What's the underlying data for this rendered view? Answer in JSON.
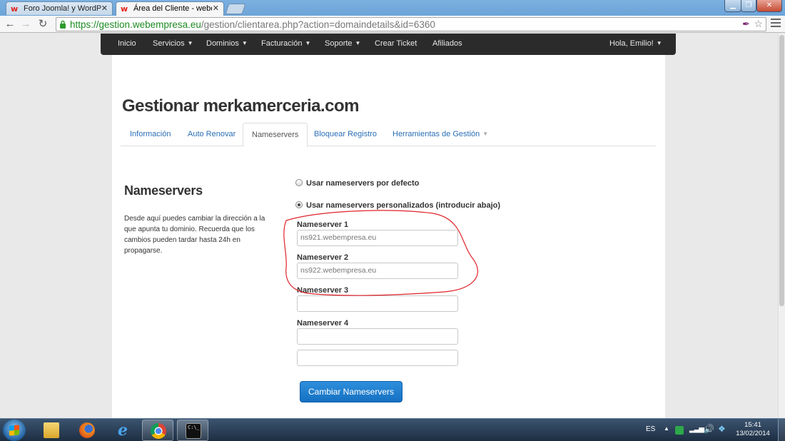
{
  "browser": {
    "tabs": [
      {
        "label": "Foro Joomla! y WordPress",
        "active": false
      },
      {
        "label": "Área del Cliente - webempresa",
        "active": true
      }
    ],
    "url": {
      "scheme": "https://",
      "host": "gestion.webempresa.eu",
      "path": "/gestion/clientarea.php?action=domaindetails&id=6360"
    }
  },
  "navbar": {
    "items": [
      {
        "label": "Inicio",
        "dropdown": false
      },
      {
        "label": "Servicios",
        "dropdown": true
      },
      {
        "label": "Dominios",
        "dropdown": true
      },
      {
        "label": "Facturación",
        "dropdown": true
      },
      {
        "label": "Soporte",
        "dropdown": true
      },
      {
        "label": "Crear Ticket",
        "dropdown": false
      },
      {
        "label": "Afiliados",
        "dropdown": false
      }
    ],
    "user_menu": "Hola, Emilio!"
  },
  "page": {
    "title": "Gestionar merkamerceria.com",
    "tabs": [
      {
        "label": "Información",
        "active": false
      },
      {
        "label": "Auto Renovar",
        "active": false
      },
      {
        "label": "Nameservers",
        "active": true
      },
      {
        "label": "Bloquear Registro",
        "active": false
      },
      {
        "label": "Herramientas de Gestión",
        "active": false,
        "dropdown": true
      }
    ]
  },
  "nameservers": {
    "title": "Nameservers",
    "description": "Desde aquí puedes cambiar la dirección a la que apunta tu dominio. Recuerda que los cambios pueden tardar hasta 24h en propagarse.",
    "option_default": "Usar nameservers por defecto",
    "option_custom": "Usar nameservers personalizados (introducir abajo)",
    "selected": "custom",
    "fields": [
      {
        "label": "Nameserver 1",
        "value": "ns921.webempresa.eu"
      },
      {
        "label": "Nameserver 2",
        "value": "ns922.webempresa.eu"
      },
      {
        "label": "Nameserver 3",
        "value": ""
      },
      {
        "label": "Nameserver 4",
        "value": ""
      },
      {
        "label": "",
        "value": ""
      }
    ],
    "submit_label": "Cambiar Nameservers"
  },
  "taskbar": {
    "language": "ES",
    "time": "15:41",
    "date": "13/02/2014"
  },
  "colors": {
    "navbar": "#2b2b2b",
    "link": "#2a6eb5",
    "primary_button": "#1a7bd0",
    "annotation": "#e0232b"
  },
  "icons": [
    "webempresa-favicon",
    "back-icon",
    "forward-icon",
    "reload-icon",
    "lock-icon",
    "star-icon",
    "menu-icon",
    "start-icon",
    "explorer-icon",
    "firefox-icon",
    "ie-icon",
    "chrome-icon",
    "cmd-icon"
  ]
}
